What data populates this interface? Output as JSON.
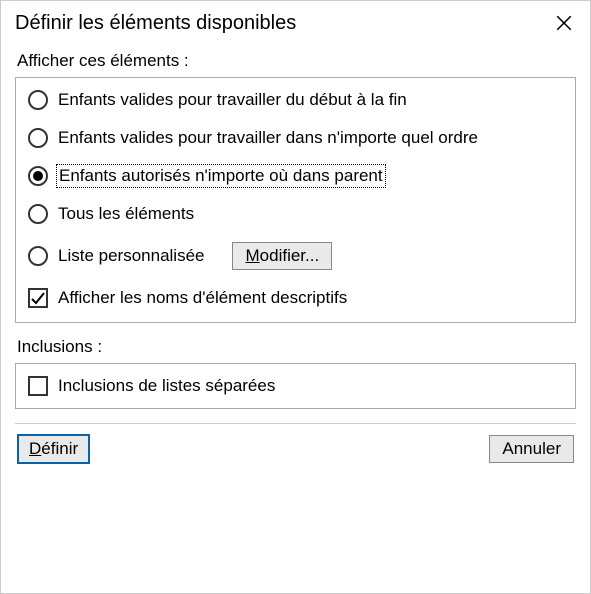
{
  "title": "Définir les éléments disponibles",
  "section1": {
    "label": "Afficher ces éléments :",
    "options": {
      "o1": "Enfants valides pour travailler du début à la fin",
      "o2": "Enfants valides pour travailler dans n'importe quel ordre",
      "o3": "Enfants autorisés n'importe où dans parent",
      "o4": "Tous les éléments",
      "o5": "Liste personnalisée"
    },
    "selected": "o3",
    "modify": "Modifier...",
    "descriptive": "Afficher les noms d'élément descriptifs",
    "descriptive_checked": true
  },
  "section2": {
    "label": "Inclusions :",
    "separate": "Inclusions de listes séparées",
    "separate_checked": false
  },
  "buttons": {
    "define": "Définir",
    "cancel": "Annuler"
  }
}
